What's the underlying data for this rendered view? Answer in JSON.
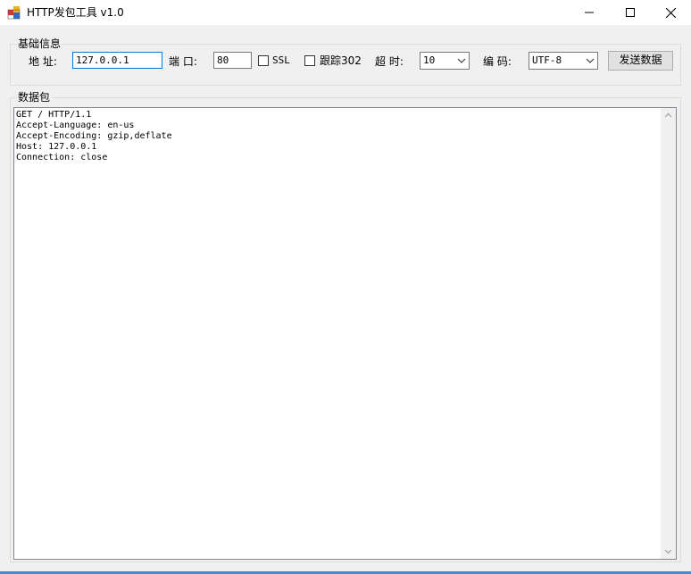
{
  "window": {
    "title": "HTTP发包工具 v1.0"
  },
  "basic_group": {
    "legend": "基础信息",
    "address_label": "地 址:",
    "address_value": "127.0.0.1",
    "port_label": "端 口:",
    "port_value": "80",
    "ssl_label": "SSL",
    "ssl_checked": false,
    "follow302_label": "跟踪302",
    "follow302_checked": false,
    "timeout_label": "超 时:",
    "timeout_value": "10",
    "encoding_label": "编 码:",
    "encoding_value": "UTF-8",
    "send_button": "发送数据"
  },
  "packet_group": {
    "legend": "数据包",
    "content": "GET / HTTP/1.1\nAccept-Language: en-us\nAccept-Encoding: gzip,deflate\nHost: 127.0.0.1\nConnection: close"
  },
  "icons": {
    "app": "app-icon",
    "minimize": "minimize-icon",
    "maximize": "maximize-icon",
    "close": "close-icon",
    "dropdown": "chevron-down-icon"
  },
  "colors": {
    "focus_border": "#0078d7",
    "window_bg": "#f0f0f0"
  }
}
